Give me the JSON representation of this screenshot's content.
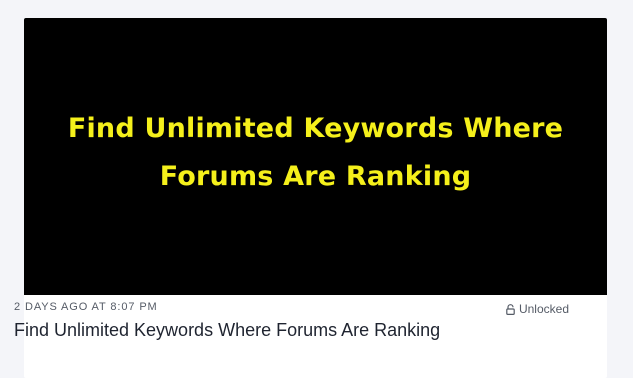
{
  "post": {
    "thumbnail_text": "Find Unlimited Keywords Where Forums Are Ranking",
    "date": "2 DAYS AGO AT 8:07 PM",
    "status": "Unlocked",
    "status_icon": "unlock-icon",
    "title": "Find Unlimited Keywords Where Forums Are Ranking"
  },
  "colors": {
    "page_background": "#f4f5f9",
    "thumbnail_background": "#000000",
    "thumbnail_text": "#f5f01b"
  }
}
